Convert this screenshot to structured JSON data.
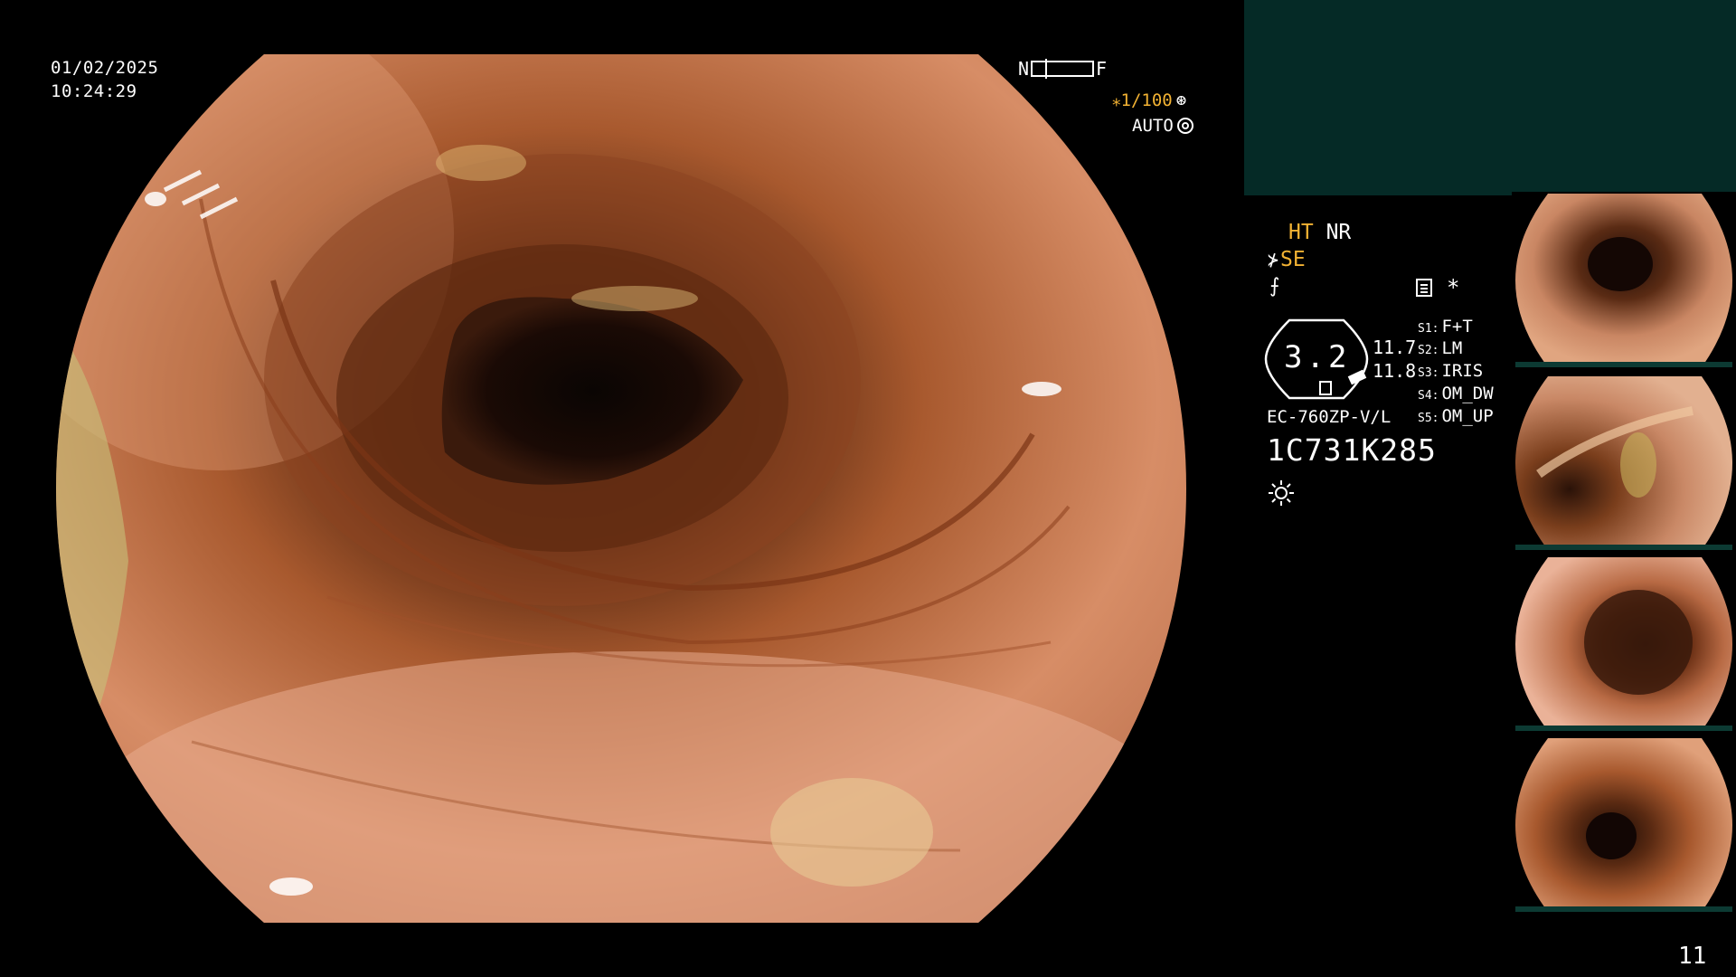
{
  "datetime": {
    "date": "01/02/2025",
    "time": "10:24:29"
  },
  "focus_bar": {
    "near_label": "N",
    "far_label": "F"
  },
  "exposure": {
    "shutter": "⁎1/100",
    "mode": "AUTO",
    "shutter_color": "#f2b233"
  },
  "enhancement": {
    "ht": "HT",
    "nr": "NR",
    "se": "SE",
    "accent_color": "#f2b233"
  },
  "gauge": {
    "value": "3.2",
    "reading_top": "11.7",
    "reading_bottom": "11.8"
  },
  "switches": [
    {
      "label": "S1:",
      "value": "F+T"
    },
    {
      "label": "S2:",
      "value": "LM"
    },
    {
      "label": "S3:",
      "value": "IRIS"
    },
    {
      "label": "S4:",
      "value": "OM_DW"
    },
    {
      "label": "S5:",
      "value": "OM_UP"
    }
  ],
  "scope": {
    "model": "EC-760ZP-V/L",
    "serial": "1C731K285"
  },
  "icons": {
    "scope_icon": "se-icon",
    "slash": "slash-icon",
    "document": "document-icon",
    "asterisk": "*",
    "brightness": "brightness-icon",
    "shutter": "aperture-icon",
    "auto": "ring-icon"
  },
  "panel": {
    "top_color": "#052a26"
  },
  "thumbnails": [
    {
      "name": "capture-1"
    },
    {
      "name": "capture-2"
    },
    {
      "name": "capture-3"
    },
    {
      "name": "capture-4"
    }
  ],
  "page_number": "11"
}
